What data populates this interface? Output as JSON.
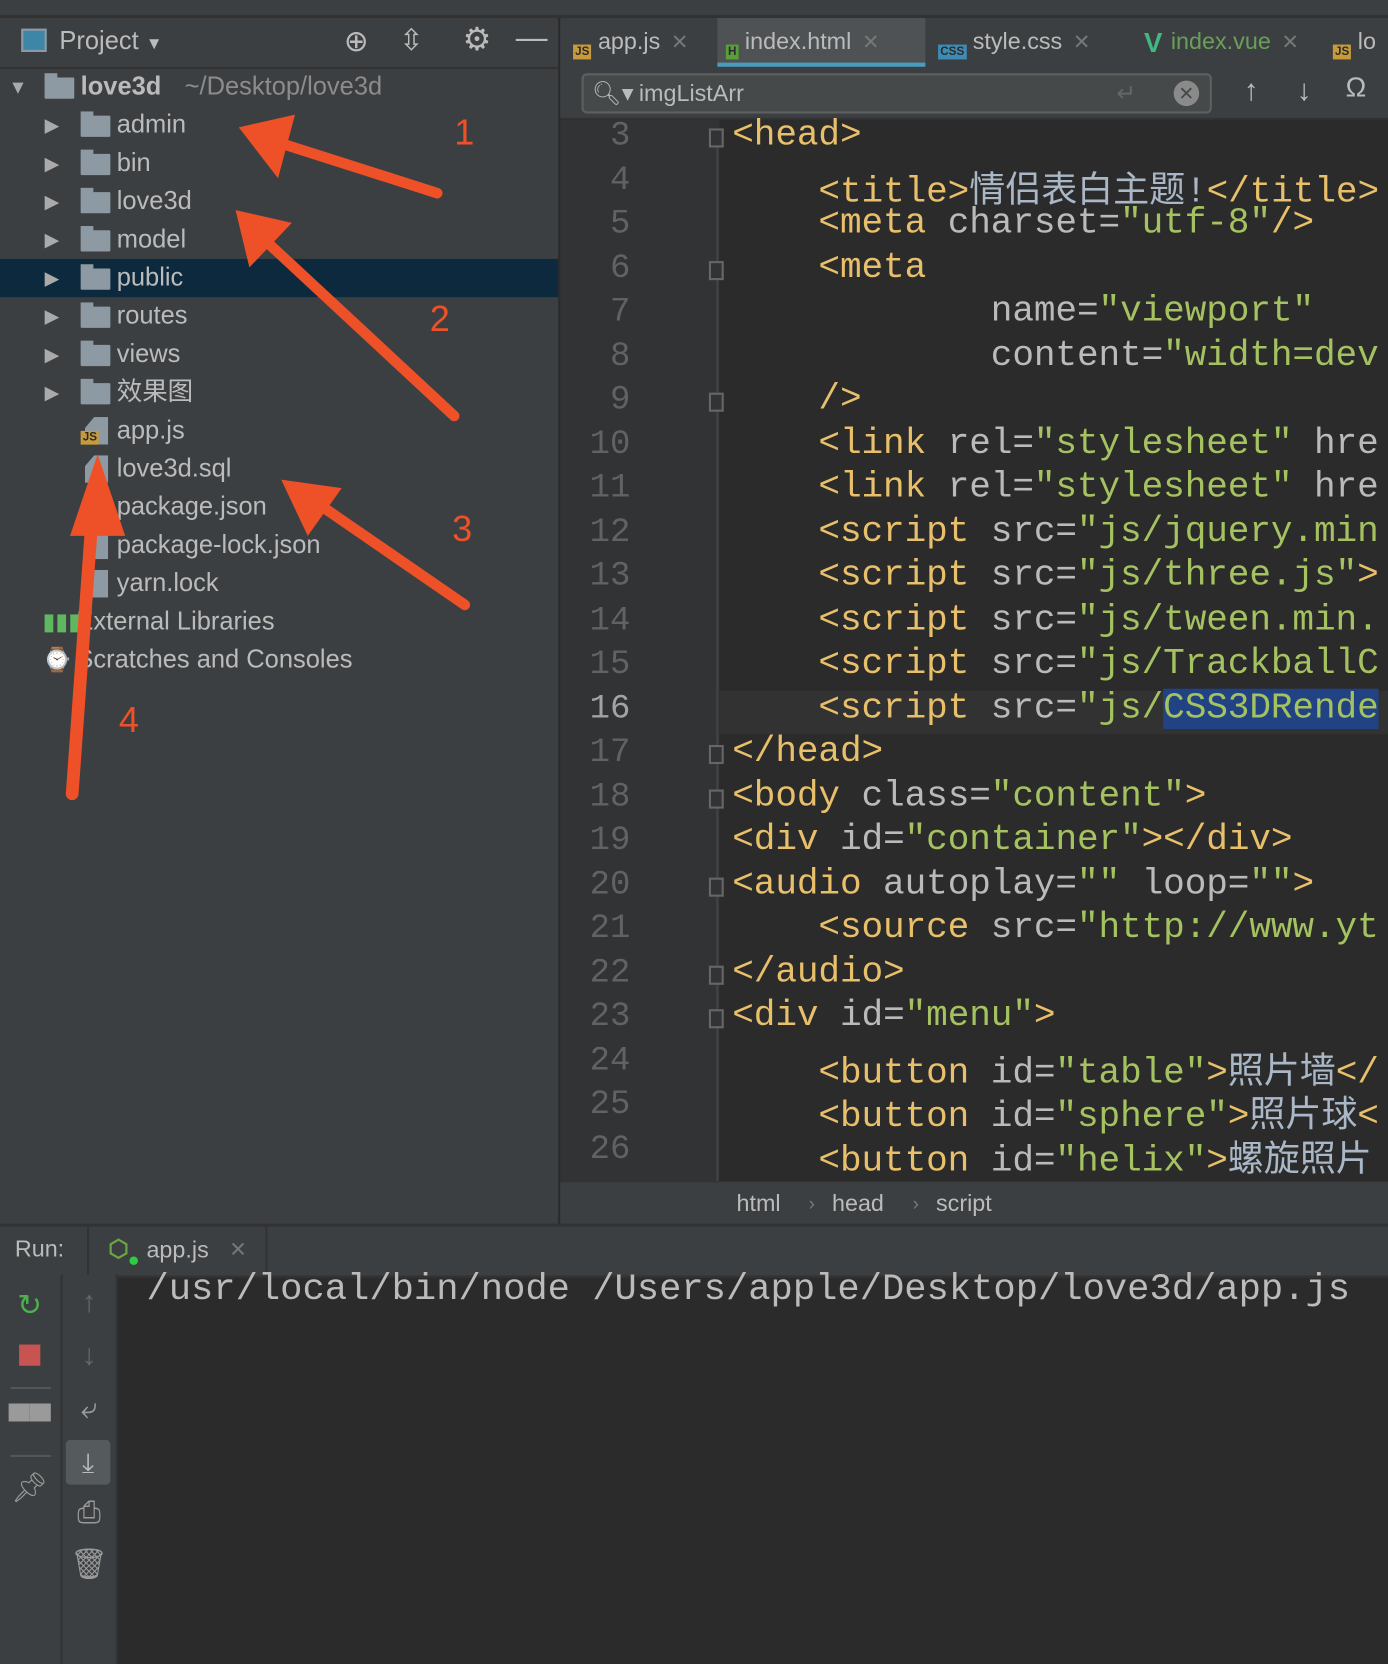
{
  "project_panel": {
    "title": "Project",
    "root": {
      "name": "love3d",
      "path": "~/Desktop/love3d"
    },
    "items": [
      {
        "label": "admin",
        "type": "folder"
      },
      {
        "label": "bin",
        "type": "folder"
      },
      {
        "label": "love3d",
        "type": "folder"
      },
      {
        "label": "model",
        "type": "folder"
      },
      {
        "label": "public",
        "type": "folder",
        "selected": true
      },
      {
        "label": "routes",
        "type": "folder"
      },
      {
        "label": "views",
        "type": "folder"
      },
      {
        "label": "效果图",
        "type": "folder"
      },
      {
        "label": "app.js",
        "type": "js"
      },
      {
        "label": "love3d.sql",
        "type": "file"
      },
      {
        "label": "package.json",
        "type": "file"
      },
      {
        "label": "package-lock.json",
        "type": "file"
      },
      {
        "label": "yarn.lock",
        "type": "file"
      }
    ],
    "extra": [
      {
        "label": "External Libraries",
        "icon": "libraries-icon"
      },
      {
        "label": "Scratches and Consoles",
        "icon": "scratches-icon"
      }
    ]
  },
  "tabs": [
    {
      "label": "app.js",
      "badge": "JS",
      "color": "#c79a3c"
    },
    {
      "label": "index.html",
      "badge": "H",
      "color": "#5a9e3a",
      "active": true
    },
    {
      "label": "style.css",
      "badge": "CSS",
      "color": "#3e8cb5"
    },
    {
      "label": "index.vue",
      "badge": "V",
      "color": "#41b883"
    },
    {
      "label": "lo",
      "badge": "JS",
      "color": "#c79a3c"
    }
  ],
  "find": {
    "value": "imgListArr"
  },
  "code": {
    "current_line": 16,
    "lines": [
      {
        "n": "3",
        "seg": [
          [
            "<head>",
            "t"
          ]
        ]
      },
      {
        "n": "4",
        "seg": [
          [
            "    <title>",
            "t"
          ],
          [
            "情侣表白主题!",
            "x"
          ],
          [
            "</title>",
            "t"
          ]
        ]
      },
      {
        "n": "5",
        "seg": [
          [
            "    <meta ",
            "t"
          ],
          [
            "charset=",
            "a"
          ],
          [
            "\"utf-8\"",
            "s"
          ],
          [
            "/>",
            "t"
          ]
        ]
      },
      {
        "n": "6",
        "seg": [
          [
            "    <meta",
            "t"
          ]
        ]
      },
      {
        "n": "7",
        "seg": [
          [
            "            name=",
            "a"
          ],
          [
            "\"viewport\"",
            "s"
          ]
        ]
      },
      {
        "n": "8",
        "seg": [
          [
            "            content=",
            "a"
          ],
          [
            "\"width=dev",
            "s"
          ]
        ]
      },
      {
        "n": "9",
        "seg": [
          [
            "    />",
            "t"
          ]
        ]
      },
      {
        "n": "10",
        "seg": [
          [
            "    <link ",
            "t"
          ],
          [
            "rel=",
            "a"
          ],
          [
            "\"stylesheet\"",
            "s"
          ],
          [
            " hre",
            "a"
          ]
        ]
      },
      {
        "n": "11",
        "seg": [
          [
            "    <link ",
            "t"
          ],
          [
            "rel=",
            "a"
          ],
          [
            "\"stylesheet\"",
            "s"
          ],
          [
            " hre",
            "a"
          ]
        ]
      },
      {
        "n": "12",
        "seg": [
          [
            "    <script ",
            "t"
          ],
          [
            "src=",
            "a"
          ],
          [
            "\"js/jquery.min",
            "s"
          ]
        ]
      },
      {
        "n": "13",
        "seg": [
          [
            "    <script ",
            "t"
          ],
          [
            "src=",
            "a"
          ],
          [
            "\"js/three.js\"",
            "s"
          ],
          [
            ">",
            "t"
          ]
        ]
      },
      {
        "n": "14",
        "seg": [
          [
            "    <script ",
            "t"
          ],
          [
            "src=",
            "a"
          ],
          [
            "\"js/tween.min.",
            "s"
          ]
        ]
      },
      {
        "n": "15",
        "seg": [
          [
            "    <script ",
            "t"
          ],
          [
            "src=",
            "a"
          ],
          [
            "\"js/TrackballC",
            "s"
          ]
        ]
      },
      {
        "n": "16",
        "seg": [
          [
            "    <script ",
            "t"
          ],
          [
            "src=",
            "a"
          ],
          [
            "\"js/",
            "s"
          ],
          [
            "CSS3DRende",
            "h"
          ]
        ]
      },
      {
        "n": "17",
        "seg": [
          [
            "</head>",
            "t"
          ]
        ]
      },
      {
        "n": "18",
        "seg": [
          [
            "<body ",
            "t"
          ],
          [
            "class=",
            "a"
          ],
          [
            "\"content\"",
            "s"
          ],
          [
            ">",
            "t"
          ]
        ]
      },
      {
        "n": "19",
        "seg": [
          [
            "<div ",
            "t"
          ],
          [
            "id=",
            "a"
          ],
          [
            "\"container\"",
            "s"
          ],
          [
            "></div>",
            "t"
          ]
        ]
      },
      {
        "n": "20",
        "seg": [
          [
            "<audio ",
            "t"
          ],
          [
            "autoplay=",
            "a"
          ],
          [
            "\"\"",
            "s"
          ],
          [
            " loop=",
            "a"
          ],
          [
            "\"\"",
            "s"
          ],
          [
            ">",
            "t"
          ]
        ]
      },
      {
        "n": "21",
        "seg": [
          [
            "    <source ",
            "t"
          ],
          [
            "src=",
            "a"
          ],
          [
            "\"http://www.yt",
            "s"
          ]
        ]
      },
      {
        "n": "22",
        "seg": [
          [
            "</audio>",
            "t"
          ]
        ]
      },
      {
        "n": "23",
        "seg": [
          [
            "<div ",
            "t"
          ],
          [
            "id=",
            "a"
          ],
          [
            "\"menu\"",
            "s"
          ],
          [
            ">",
            "t"
          ]
        ]
      },
      {
        "n": "24",
        "seg": [
          [
            "    <button ",
            "t"
          ],
          [
            "id=",
            "a"
          ],
          [
            "\"table\"",
            "s"
          ],
          [
            ">",
            "t"
          ],
          [
            "照片墙",
            "x"
          ],
          [
            "</",
            "t"
          ]
        ]
      },
      {
        "n": "25",
        "seg": [
          [
            "    <button ",
            "t"
          ],
          [
            "id=",
            "a"
          ],
          [
            "\"sphere\"",
            "s"
          ],
          [
            ">",
            "t"
          ],
          [
            "照片球",
            "x"
          ],
          [
            "<",
            "t"
          ]
        ]
      },
      {
        "n": "26",
        "seg": [
          [
            "    <button ",
            "t"
          ],
          [
            "id=",
            "a"
          ],
          [
            "\"helix\"",
            "s"
          ],
          [
            ">",
            "t"
          ],
          [
            "螺旋照片",
            "x"
          ]
        ]
      }
    ]
  },
  "breadcrumb": [
    "html",
    "head",
    "script"
  ],
  "run": {
    "label": "Run:",
    "tab": "app.js",
    "output": "/usr/local/bin/node /Users/apple/Desktop/love3d/app.js"
  },
  "annotations": {
    "color": "#ee5127",
    "labels": [
      "1",
      "2",
      "3",
      "4"
    ]
  }
}
